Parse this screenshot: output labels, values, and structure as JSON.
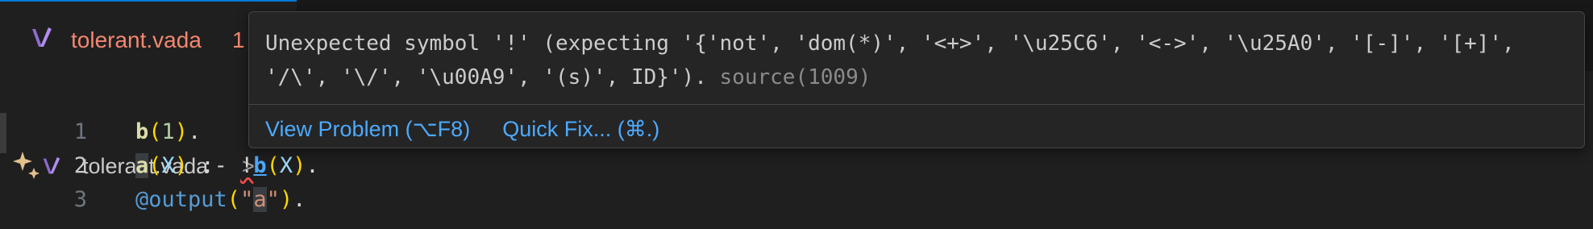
{
  "tab": {
    "label": "tolerant.vada",
    "problem_count": "1",
    "icon": "vada-file-icon"
  },
  "breadcrumb": {
    "file": "tolerant.vada",
    "separator": ">"
  },
  "editor": {
    "lines": [
      {
        "number": "1"
      },
      {
        "number": "2"
      },
      {
        "number": "3"
      }
    ],
    "code": {
      "l1_fn": "b",
      "l1_p1": "(",
      "l1_num": "1",
      "l1_p2": ")",
      "l1_end": ".",
      "l2_a": "a",
      "l2_p1": "(",
      "l2_x1": "X",
      "l2_p2": ")",
      "l2_op": " :- ",
      "l2_bang": "!",
      "l2_b": "b",
      "l2_p3": "(",
      "l2_x2": "X",
      "l2_p4": ")",
      "l2_end": ".",
      "l3_dec": "@output",
      "l3_p1": "(",
      "l3_q1": "\"",
      "l3_str": "a",
      "l3_q2": "\"",
      "l3_p2": ")",
      "l3_end": "."
    }
  },
  "hover": {
    "message": "Unexpected symbol '!' (expecting '{'not', 'dom(*)', '<+>', '\\u25C6', '<->', '\\u25A0', '[-]', '[+]', '/\\', '\\/', '\\u00A9', '(s)', ID}'). ",
    "source": "source(1009)",
    "view_problem": "View Problem (⌥F8)",
    "quick_fix": "Quick Fix... (⌘.)"
  },
  "colors": {
    "error": "#f48771",
    "link": "#4daafc",
    "icon": "#8e6bd1"
  }
}
